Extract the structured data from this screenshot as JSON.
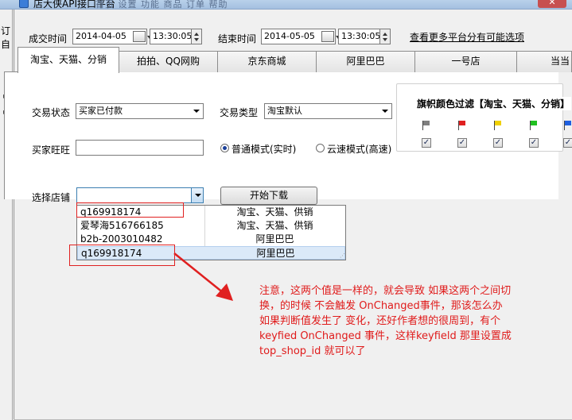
{
  "window": {
    "title": "店大侠API接口平台",
    "menu_faint": "首页  设置  功能  商品  订单  帮助",
    "close": "✕"
  },
  "left_strip": {
    "t1": "订自",
    "t2": "▸",
    "t3": "▸"
  },
  "top_row": {
    "deal_time_label": "成交时间",
    "start_date": "2014-04-05",
    "start_time": "13:30:05",
    "end_time_label": "结束时间",
    "end_date": "2014-05-05",
    "end_time": "13:30:05",
    "more_platforms_link": "查看更多平台分有可能选项"
  },
  "tabs": [
    {
      "label": "淘宝、天猫、分销"
    },
    {
      "label": "拍拍、QQ网购"
    },
    {
      "label": "京东商城"
    },
    {
      "label": "阿里巴巴"
    },
    {
      "label": "一号店"
    },
    {
      "label": "当当"
    }
  ],
  "filters": {
    "trade_status_label": "交易状态",
    "trade_status_value": "买家已付款",
    "trade_type_label": "交易类型",
    "trade_type_value": "淘宝默认",
    "buyer_label": "买家旺旺",
    "buyer_value": "",
    "mode_normal": "普通模式(实时)",
    "mode_cloud": "云速模式(高速)"
  },
  "flag_filter": {
    "title": "旗帜颜色过滤【淘宝、天猫、分销】",
    "flags": [
      {
        "color": "#7f7f7f",
        "checked": "✓"
      },
      {
        "color": "#e02020",
        "checked": "✓"
      },
      {
        "color": "#f0d000",
        "checked": "✓"
      },
      {
        "color": "#20c020",
        "checked": "✓"
      },
      {
        "color": "#2060e0",
        "checked": "✓"
      }
    ]
  },
  "shop_select": {
    "label": "选择店铺",
    "value": "",
    "start_button": "开始下载"
  },
  "dropdown_rows": [
    {
      "shop": "q169918174",
      "platform": "淘宝、天猫、供销"
    },
    {
      "shop": "爱琴海516766185",
      "platform": "淘宝、天猫、供销"
    },
    {
      "shop": "b2b-2003010482",
      "platform": "阿里巴巴"
    },
    {
      "shop": "q169918174",
      "platform": "阿里巴巴"
    }
  ],
  "annotation": {
    "lines": [
      "注意，这两个值是一样的，就会导致 如果这两个之间切",
      "换，的时候 不会触发 OnChanged事件，那该怎么办",
      "如果判断值发生了 变化，还好作者想的很周到，有个",
      "keyfied OnChanged 事件，这样keyfield 那里设置成",
      "top_shop_id 就可以了"
    ],
    "color": "#e01b1b"
  }
}
